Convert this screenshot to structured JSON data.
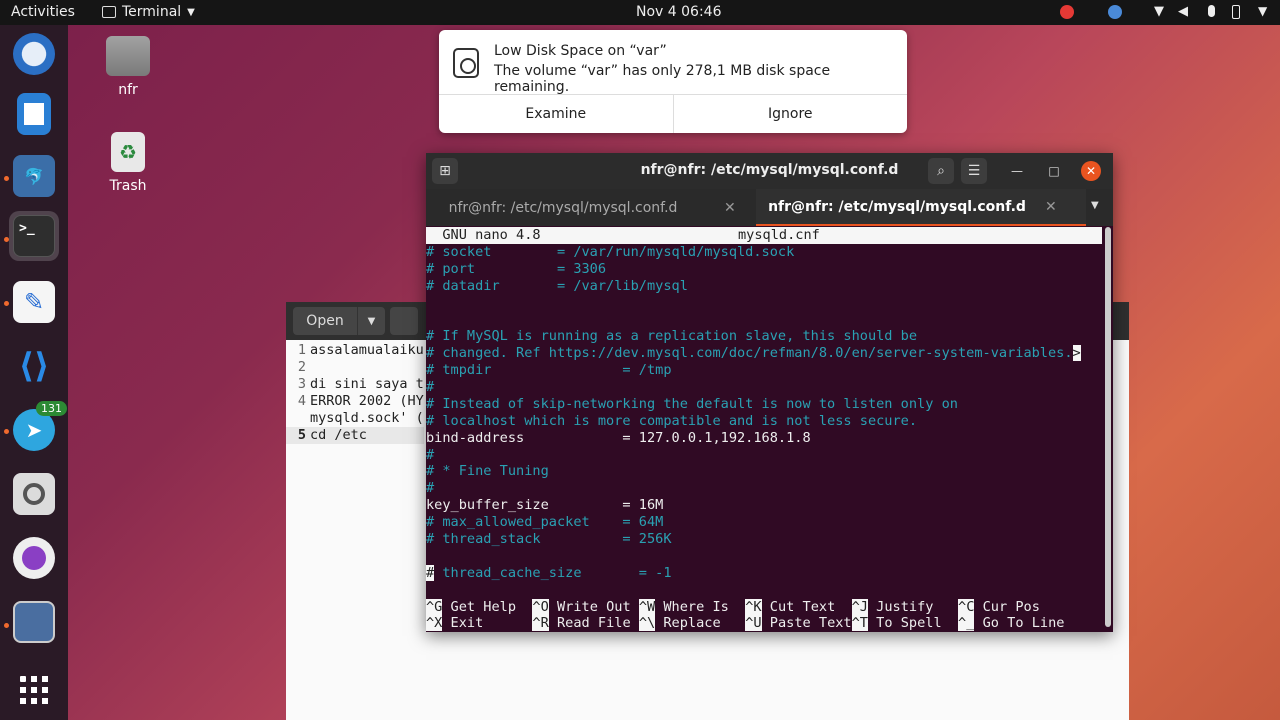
{
  "topbar": {
    "activities": "Activities",
    "app_name": "Terminal",
    "clock": "Nov 4  06:46"
  },
  "dock": {
    "telegram_badge": "131"
  },
  "desktop": {
    "home_label": "nfr",
    "trash_label": "Trash"
  },
  "notification": {
    "title": "Low Disk Space on “var”",
    "body": "The volume “var” has only 278,1 MB disk space remaining.",
    "examine": "Examine",
    "ignore": "Ignore"
  },
  "gedit": {
    "open_label": "Open",
    "lines": [
      {
        "num": "1",
        "text": "assalamualaiku"
      },
      {
        "num": "2",
        "text": ""
      },
      {
        "num": "3",
        "text": "di sini saya t"
      },
      {
        "num": "4",
        "text": "ERROR 2002 (HY"
      },
      {
        "num": "",
        "text": "mysqld.sock' ("
      },
      {
        "num": "5",
        "text": "cd /etc"
      }
    ]
  },
  "terminal": {
    "title": "nfr@nfr: /etc/mysql/mysql.conf.d",
    "tab1": "nfr@nfr: /etc/mysql/mysql.conf.d",
    "tab2": "nfr@nfr: /etc/mysql/mysql.conf.d",
    "nano_header_left": "  GNU nano 4.8",
    "nano_header_file": "mysqld.cnf",
    "lines": [
      {
        "t": "# socket        = /var/run/mysqld/mysqld.sock",
        "c": "cm"
      },
      {
        "t": "# port          = 3306",
        "c": "cm"
      },
      {
        "t": "# datadir       = /var/lib/mysql",
        "c": "cm"
      },
      {
        "t": "",
        "c": ""
      },
      {
        "t": "",
        "c": ""
      },
      {
        "t": "# If MySQL is running as a replication slave, this should be",
        "c": "cm"
      },
      {
        "t": "# changed. Ref https://dev.mysql.com/doc/refman/8.0/en/server-system-variables.",
        "c": "cm",
        "more": ">"
      },
      {
        "t": "# tmpdir                = /tmp",
        "c": "cm"
      },
      {
        "t": "#",
        "c": "cm"
      },
      {
        "t": "# Instead of skip-networking the default is now to listen only on",
        "c": "cm"
      },
      {
        "t": "# localhost which is more compatible and is not less secure.",
        "c": "cm"
      },
      {
        "t": "bind-address            = 127.0.0.1,192.168.1.8",
        "c": ""
      },
      {
        "t": "#",
        "c": "cm"
      },
      {
        "t": "# * Fine Tuning",
        "c": "cm"
      },
      {
        "t": "#",
        "c": "cm"
      },
      {
        "t": "key_buffer_size         = 16M",
        "c": ""
      },
      {
        "t": "# max_allowed_packet    = 64M",
        "c": "cm"
      },
      {
        "t": "# thread_stack          = 256K",
        "c": "cm"
      },
      {
        "t": "",
        "c": ""
      },
      {
        "t": "# thread_cache_size       = -1",
        "c": "cm",
        "cursor": true
      },
      {
        "t": "",
        "c": ""
      }
    ],
    "shortcuts": [
      [
        {
          "k": "^G",
          "l": " Get Help  "
        },
        {
          "k": "^O",
          "l": " Write Out "
        },
        {
          "k": "^W",
          "l": " Where Is  "
        },
        {
          "k": "^K",
          "l": " Cut Text  "
        },
        {
          "k": "^J",
          "l": " Justify   "
        },
        {
          "k": "^C",
          "l": " Cur Pos"
        }
      ],
      [
        {
          "k": "^X",
          "l": " Exit      "
        },
        {
          "k": "^R",
          "l": " Read File "
        },
        {
          "k": "^\\",
          "l": " Replace   "
        },
        {
          "k": "^U",
          "l": " Paste Text"
        },
        {
          "k": "^T",
          "l": " To Spell  "
        },
        {
          "k": "^_",
          "l": " Go To Line"
        }
      ]
    ]
  },
  "colors": {
    "accent": "#e95420",
    "terminal_bg": "#300a24",
    "comment": "#2aa1b3"
  }
}
